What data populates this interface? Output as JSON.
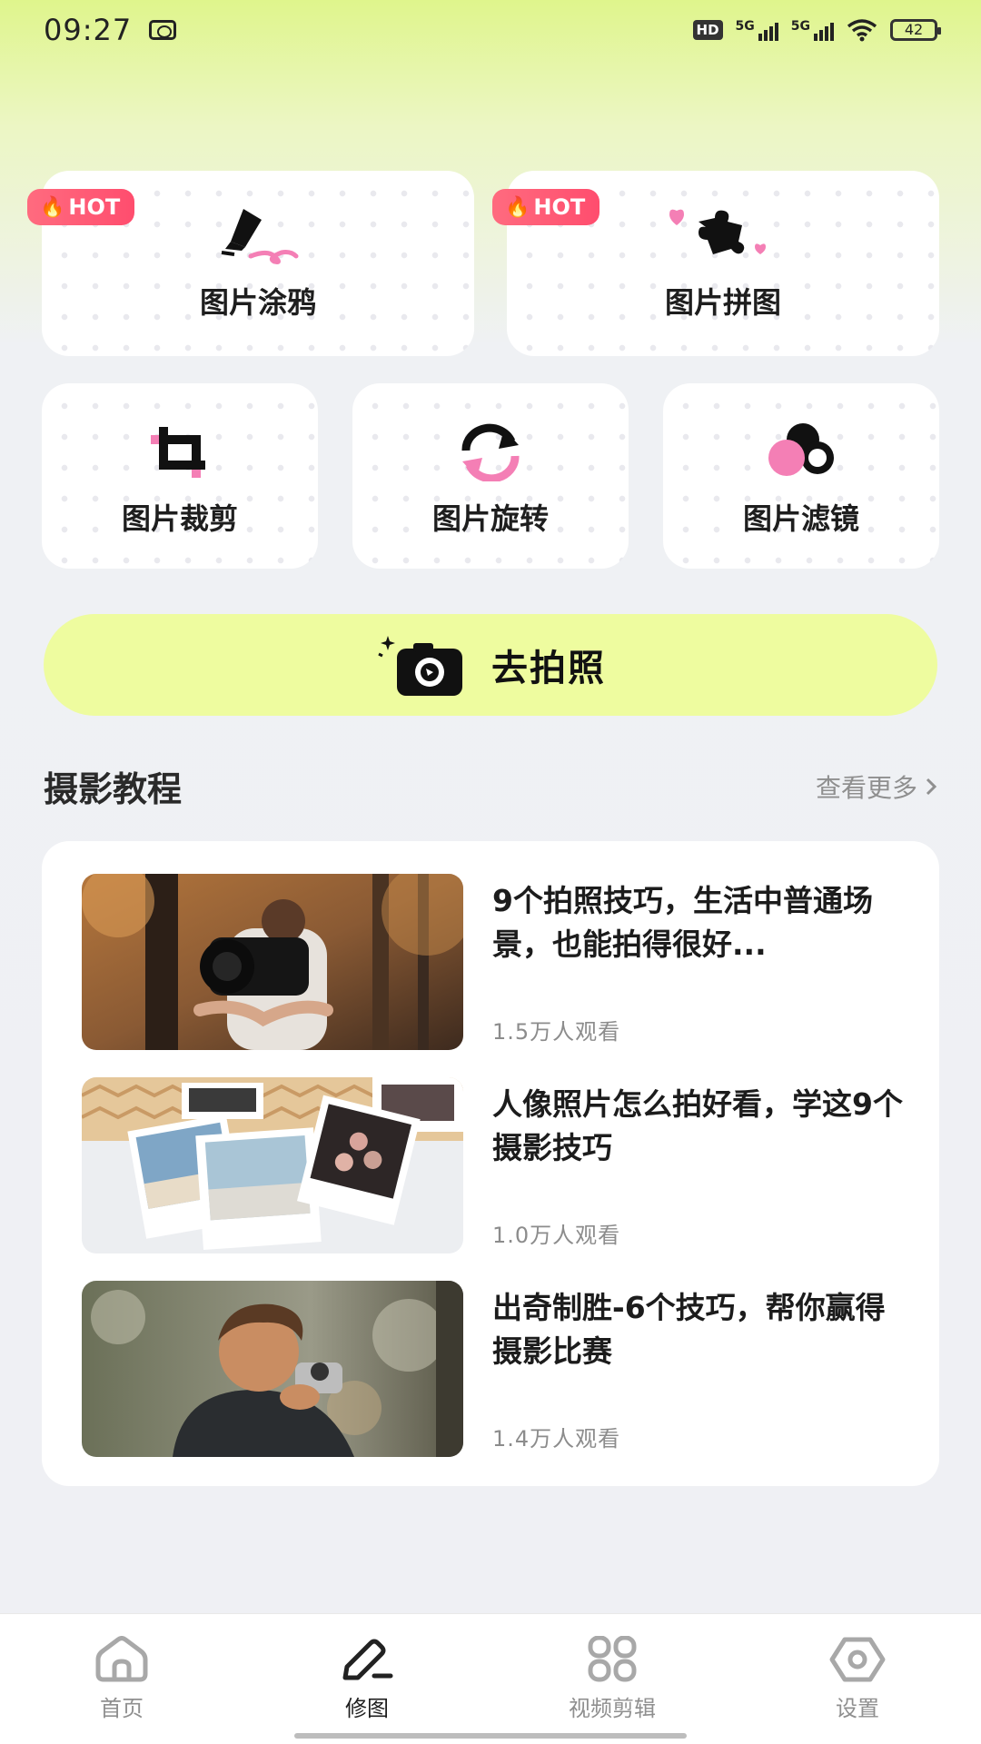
{
  "status_bar": {
    "time": "09:27",
    "hd": "HD",
    "signal_label": "5G",
    "battery": "42"
  },
  "features": {
    "hot_label": "HOT",
    "doodle": "图片涂鸦",
    "collage": "图片拼图",
    "crop": "图片裁剪",
    "rotate": "图片旋转",
    "filter": "图片滤镜"
  },
  "photo_button": {
    "label": "去拍照"
  },
  "tutorials": {
    "section_title": "摄影教程",
    "more_label": "查看更多",
    "items": [
      {
        "title": "9个拍照技巧，生活中普通场景，也能拍得很好...",
        "views": "1.5万人观看"
      },
      {
        "title": "人像照片怎么拍好看，学这9个摄影技巧",
        "views": "1.0万人观看"
      },
      {
        "title": "出奇制胜-6个技巧，帮你赢得摄影比赛",
        "views": "1.4万人观看"
      }
    ]
  },
  "bottom_nav": {
    "items": [
      {
        "label": "首页",
        "icon": "home-icon"
      },
      {
        "label": "修图",
        "icon": "edit-pen-icon",
        "active": true
      },
      {
        "label": "视频剪辑",
        "icon": "grid-icon"
      },
      {
        "label": "设置",
        "icon": "settings-hexagon-icon"
      }
    ]
  },
  "colors": {
    "accent_lime": "#eefc9f",
    "hot_badge": "#ff5872",
    "icon_pink": "#f47fb5"
  }
}
